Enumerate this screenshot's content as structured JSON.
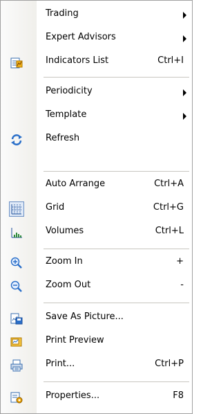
{
  "menu": {
    "items": [
      {
        "label": "Trading",
        "shortcut": "",
        "submenu": true,
        "icon": ""
      },
      {
        "label": "Expert Advisors",
        "shortcut": "",
        "submenu": true,
        "icon": ""
      },
      {
        "label": "Indicators List",
        "shortcut": "Ctrl+I",
        "submenu": false,
        "icon": "indicators-list-icon"
      },
      {
        "label": "Periodicity",
        "shortcut": "",
        "submenu": true,
        "icon": ""
      },
      {
        "label": "Template",
        "shortcut": "",
        "submenu": true,
        "icon": ""
      },
      {
        "label": "Refresh",
        "shortcut": "",
        "submenu": false,
        "icon": "refresh-icon"
      },
      {
        "label": "Auto Arrange",
        "shortcut": "Ctrl+A",
        "submenu": false,
        "icon": ""
      },
      {
        "label": "Grid",
        "shortcut": "Ctrl+G",
        "submenu": false,
        "icon": "grid-icon"
      },
      {
        "label": "Volumes",
        "shortcut": "Ctrl+L",
        "submenu": false,
        "icon": "volumes-icon"
      },
      {
        "label": "Zoom In",
        "shortcut": "+",
        "submenu": false,
        "icon": "zoom-in-icon"
      },
      {
        "label": "Zoom Out",
        "shortcut": "-",
        "submenu": false,
        "icon": "zoom-out-icon"
      },
      {
        "label": "Save As Picture...",
        "shortcut": "",
        "submenu": false,
        "icon": "save-picture-icon"
      },
      {
        "label": "Print Preview",
        "shortcut": "",
        "submenu": false,
        "icon": "print-preview-icon"
      },
      {
        "label": "Print...",
        "shortcut": "Ctrl+P",
        "submenu": false,
        "icon": "printer-icon"
      },
      {
        "label": "Properties...",
        "shortcut": "F8",
        "submenu": false,
        "icon": "properties-icon"
      }
    ]
  },
  "colors": {
    "accent_blue": "#2a6fc9",
    "accent_green": "#2e8b3a",
    "accent_orange": "#e8a000"
  }
}
